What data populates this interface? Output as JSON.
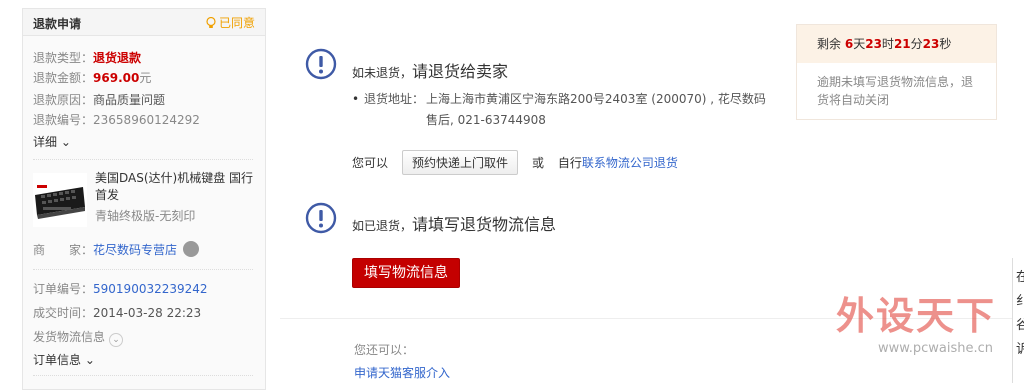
{
  "sidebar": {
    "title": "退款申请",
    "status": "已同意",
    "rows": [
      {
        "label": "退款类型：",
        "value": "退货退款"
      },
      {
        "label": "退款金额：",
        "value": "969.00",
        "unit": "元"
      },
      {
        "label": "退款原因：",
        "value": "商品质量问题"
      },
      {
        "label": "退款编号：",
        "value": "23658960124292"
      }
    ],
    "detail_toggle": "详细",
    "product": {
      "name": "美国DAS(达什)机械键盘 国行首发",
      "spec": "青轴终极版-无刻印"
    },
    "seller_label": "商　　家：",
    "seller_name": "花尽数码专营店",
    "order_no_label": "订单编号：",
    "order_no": "590190032239242",
    "deal_time_label": "成交时间：",
    "deal_time": "2014-03-28 22:23",
    "shipping_info": "发货物流信息",
    "order_info": "订单信息"
  },
  "main": {
    "step1": {
      "prefix": "如未退货，",
      "title": "请退货给卖家",
      "addr_label": "退货地址：",
      "addr_text": "上海上海市黄浦区宁海东路200号2403室 (200070) , 花尽数码售后, 021-63744908",
      "can_label": "您可以",
      "button": "预约快递上门取件",
      "or": "或",
      "self_text": "自行",
      "self_link": "联系物流公司退货"
    },
    "step2": {
      "prefix": "如已退货，",
      "title": "请填写退货物流信息",
      "button": "填写物流信息"
    },
    "also_label": "您还可以：",
    "also_link": "申请天猫客服介入"
  },
  "countdown": {
    "prefix": "剩余",
    "days": "6",
    "days_unit": "天",
    "hours": "23",
    "hours_unit": "时",
    "minutes": "21",
    "minutes_unit": "分",
    "seconds": "23",
    "seconds_unit": "秒",
    "note": "逾期未填写退货物流信息，退货将自动关闭"
  },
  "watermark": {
    "text": "外设天下",
    "url": "www.pcwaishe.cn"
  },
  "edge_chars": [
    "在",
    "纟",
    "谷",
    "诉"
  ],
  "colors": {
    "accent_red": "#c40000",
    "link_blue": "#3366cc",
    "status_orange": "#f0a000"
  }
}
